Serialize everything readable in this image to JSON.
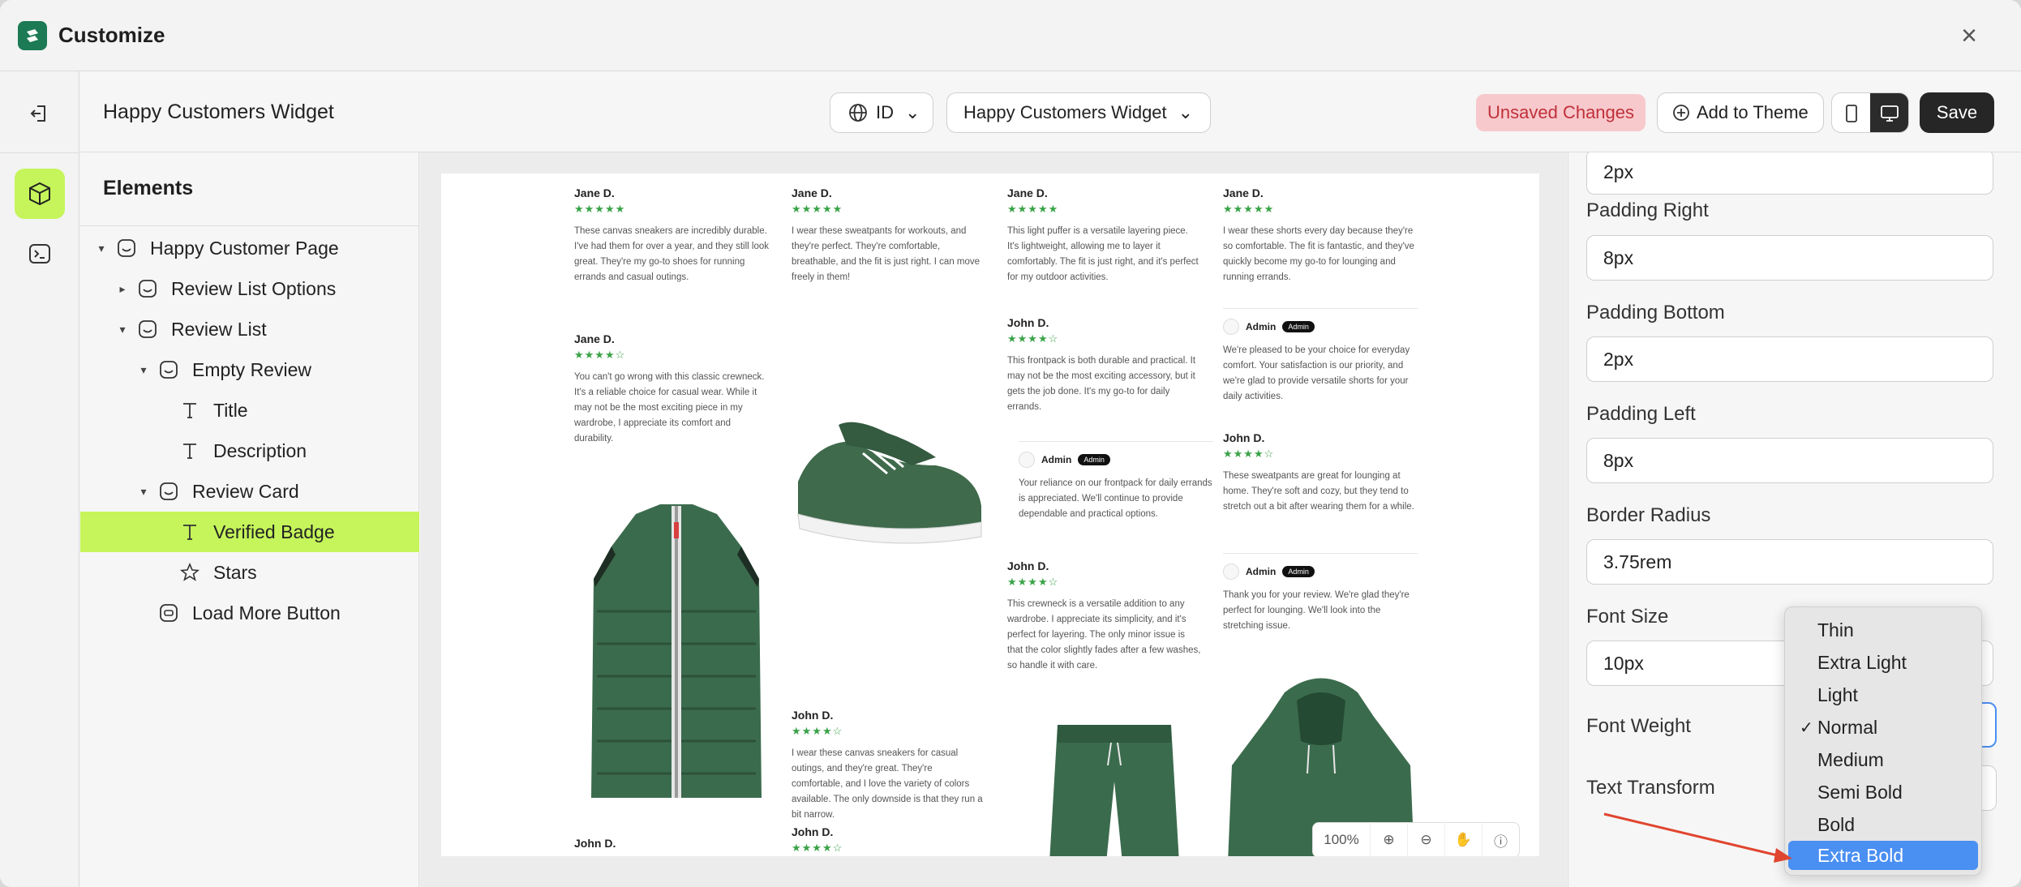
{
  "window": {
    "title": "Customize"
  },
  "header": {
    "page_name": "Happy Customers Widget",
    "language": "ID",
    "template_select": "Happy Customers Widget",
    "unsaved_label": "Unsaved Changes",
    "add_theme_label": "Add to Theme",
    "save_label": "Save"
  },
  "elements_panel": {
    "title": "Elements",
    "tree": [
      {
        "label": "Happy Customer Page",
        "icon": "section-icon"
      },
      {
        "label": "Review List Options",
        "icon": "section-icon"
      },
      {
        "label": "Review List",
        "icon": "section-icon"
      },
      {
        "label": "Empty Review",
        "icon": "section-icon"
      },
      {
        "label": "Title",
        "icon": "text-icon"
      },
      {
        "label": "Description",
        "icon": "text-icon"
      },
      {
        "label": "Review Card",
        "icon": "section-icon"
      },
      {
        "label": "Verified Badge",
        "icon": "text-icon"
      },
      {
        "label": "Stars",
        "icon": "star-icon"
      },
      {
        "label": "Load More Button",
        "icon": "button-icon"
      }
    ]
  },
  "preview": {
    "reviews": [
      {
        "name": "Jane D.",
        "stars": "★★★★★",
        "text": "These canvas sneakers are incredibly durable. I've had them for over a year, and they still look great. They're my go-to shoes for running errands and casual outings."
      },
      {
        "name": "Jane D.",
        "stars": "★★★★☆",
        "text": "You can't go wrong with this classic crewneck. It's a reliable choice for casual wear. While it may not be the most exciting piece in my wardrobe, I appreciate its comfort and durability."
      },
      {
        "name": "John D.",
        "stars": "",
        "text": ""
      },
      {
        "name": "Jane D.",
        "stars": "★★★★★",
        "text": "I wear these sweatpants for workouts, and they're perfect. They're comfortable, breathable, and the fit is just right. I can move freely in them!"
      },
      {
        "name": "John D.",
        "stars": "★★★★☆",
        "text": "I wear these canvas sneakers for casual outings, and they're great. They're comfortable, and I love the variety of colors available. The only downside is that they run a bit narrow."
      },
      {
        "name": "John D.",
        "stars": "★★★★☆",
        "text": ""
      },
      {
        "name": "Jane D.",
        "stars": "★★★★★",
        "text": "This light puffer is a versatile layering piece. It's lightweight, allowing me to layer it comfortably. The fit is just right, and it's perfect for my outdoor activities."
      },
      {
        "name": "John D.",
        "stars": "★★★★☆",
        "text": "This frontpack is both durable and practical. It may not be the most exciting accessory, but it gets the job done. It's my go-to for daily errands."
      },
      {
        "name": "John D.",
        "stars": "★★★★☆",
        "text": "This crewneck is a versatile addition to any wardrobe. I appreciate its simplicity, and it's perfect for layering. The only minor issue is that the color slightly fades after a few washes, so handle it with care."
      },
      {
        "name": "Jane D.",
        "stars": "★★★★★",
        "text": "I wear these shorts every day because they're so comfortable. The fit is fantastic, and they've quickly become my go-to for lounging and running errands."
      },
      {
        "name": "John D.",
        "stars": "★★★★☆",
        "text": "These sweatpants are great for lounging at home. They're soft and cozy, but they tend to stretch out a bit after wearing them for a while."
      }
    ],
    "replies": [
      {
        "who": "Admin",
        "tag": "Admin",
        "text": "Your reliance on our frontpack for daily errands is appreciated. We'll continue to provide dependable and practical options."
      },
      {
        "who": "Admin",
        "tag": "Admin",
        "text": "We're pleased to be your choice for everyday comfort. Your satisfaction is our priority, and we're glad to provide versatile shorts for your daily activities."
      },
      {
        "who": "Admin",
        "tag": "Admin",
        "text": "Thank you for your review. We're glad they're perfect for lounging. We'll look into the stretching issue."
      }
    ],
    "zoom": "100%"
  },
  "properties": {
    "padding_top_value": "2px",
    "padding_right_label": "Padding Right",
    "padding_right_value": "8px",
    "padding_bottom_label": "Padding Bottom",
    "padding_bottom_value": "2px",
    "padding_left_label": "Padding Left",
    "padding_left_value": "8px",
    "border_radius_label": "Border Radius",
    "border_radius_value": "3.75rem",
    "font_size_label": "Font Size",
    "font_size_value": "10px",
    "font_weight_label": "Font Weight",
    "text_transform_label": "Text Transform"
  },
  "font_weight_dropdown": {
    "options": [
      "Thin",
      "Extra Light",
      "Light",
      "Normal",
      "Medium",
      "Semi Bold",
      "Bold",
      "Extra Bold"
    ],
    "checked": "Normal",
    "highlighted": "Extra Bold"
  },
  "colors": {
    "accent": "#c5f55b",
    "highlight": "#4a8ff2",
    "unsaved_bg": "#f7c9cc",
    "unsaved_text": "#c0303b",
    "annotation_arrow": "#e0452f"
  }
}
